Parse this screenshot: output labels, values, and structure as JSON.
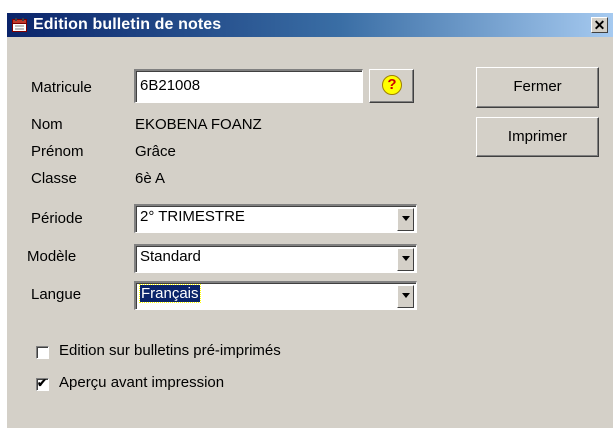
{
  "window": {
    "title": "Edition bulletin de notes",
    "close_glyph": "✕"
  },
  "form": {
    "matricule_label": "Matricule",
    "matricule_value": "6B21008",
    "help_glyph": "?",
    "nom_label": "Nom",
    "nom_value": "EKOBENA FOANZ",
    "prenom_label": "Prénom",
    "prenom_value": "Grâce",
    "classe_label": "Classe",
    "classe_value": "6è A",
    "periode_label": "Période",
    "periode_value": "2° TRIMESTRE",
    "modele_label": "Modèle",
    "modele_value": "Standard",
    "langue_label": "Langue",
    "langue_value": "Français"
  },
  "buttons": {
    "fermer": "Fermer",
    "imprimer": "Imprimer"
  },
  "options": {
    "preprint_label": "Edition sur bulletins pré-imprimés",
    "preprint_checked": false,
    "preview_label": "Aperçu avant impression",
    "preview_checked": true,
    "check_glyph": "✔"
  },
  "icons": {
    "title": "calendar-icon",
    "help": "question-icon"
  },
  "colors": {
    "titlebar_start": "#0a246a",
    "titlebar_end": "#a6caf0",
    "selection": "#0a246a",
    "help_yellow": "#ffff00"
  }
}
